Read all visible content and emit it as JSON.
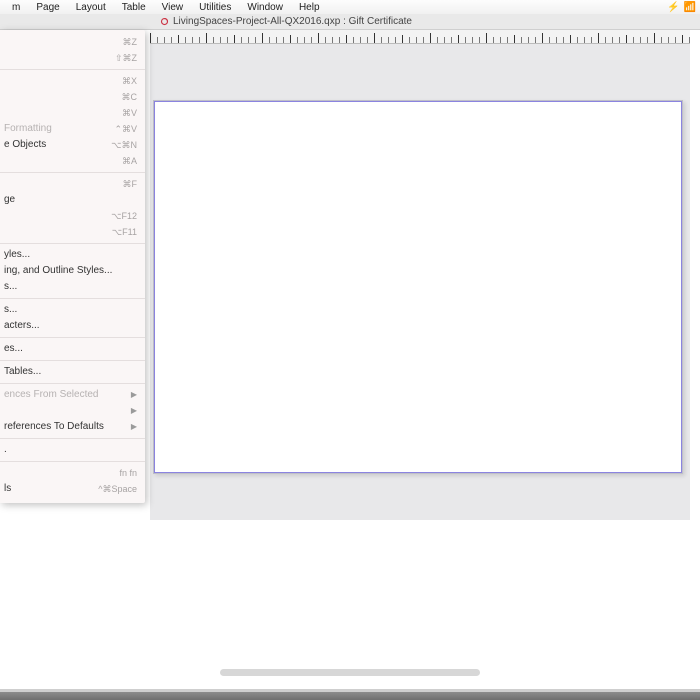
{
  "menubar": {
    "items": [
      "m",
      "Page",
      "Layout",
      "Table",
      "View",
      "Utilities",
      "Window",
      "Help"
    ]
  },
  "menubar_right": {
    "wifi": "⚡",
    "sig": "📶"
  },
  "tab": {
    "title": "LivingSpaces-Project-All-QX2016.qxp : Gift Certificate"
  },
  "menu": {
    "undo": {
      "label": "",
      "shortcut": "⌘Z"
    },
    "redo": {
      "label": "",
      "shortcut": "⇧⌘Z"
    },
    "cut": {
      "label": "",
      "shortcut": "⌘X"
    },
    "copy": {
      "label": "",
      "shortcut": "⌘C"
    },
    "paste": {
      "label": "",
      "shortcut": "⌘V"
    },
    "paste_wo": {
      "label": "Formatting",
      "shortcut": "⌃⌘V"
    },
    "paste_in_place": {
      "label": "",
      "shortcut": ""
    },
    "paste_objects": {
      "label": "e Objects",
      "shortcut": "⌥⌘N"
    },
    "select_all": {
      "label": "",
      "shortcut": "⌘A"
    },
    "find": {
      "label": "",
      "shortcut": "⌘F"
    },
    "item_find": {
      "label": "ge",
      "shortcut": ""
    },
    "prev": {
      "label": "",
      "shortcut": "⌥F12"
    },
    "next": {
      "label": "",
      "shortcut": "⌥F11"
    },
    "stylesheets": {
      "label": "yles...",
      "shortcut": ""
    },
    "bno": {
      "label": "ing, and Outline Styles...",
      "shortcut": ""
    },
    "conditional": {
      "label": "s...",
      "shortcut": ""
    },
    "item_styles": {
      "label": "s...",
      "shortcut": ""
    },
    "special_chars": {
      "label": "acters...",
      "shortcut": ""
    },
    "callout_styles": {
      "label": "es...",
      "shortcut": ""
    },
    "inline_tables": {
      "label": "Tables...",
      "shortcut": ""
    },
    "update_from_sel": {
      "label": "ences From Selected",
      "shortcut": ""
    },
    "apply_all": {
      "label": "",
      "shortcut": ""
    },
    "revert_defaults": {
      "label": "references To Defaults",
      "shortcut": ""
    },
    "dots": {
      "label": ".",
      "shortcut": ""
    },
    "fnfn": {
      "label": "",
      "shortcut": "fn fn"
    },
    "special": {
      "label": "ls",
      "shortcut": "^⌘Space"
    }
  }
}
